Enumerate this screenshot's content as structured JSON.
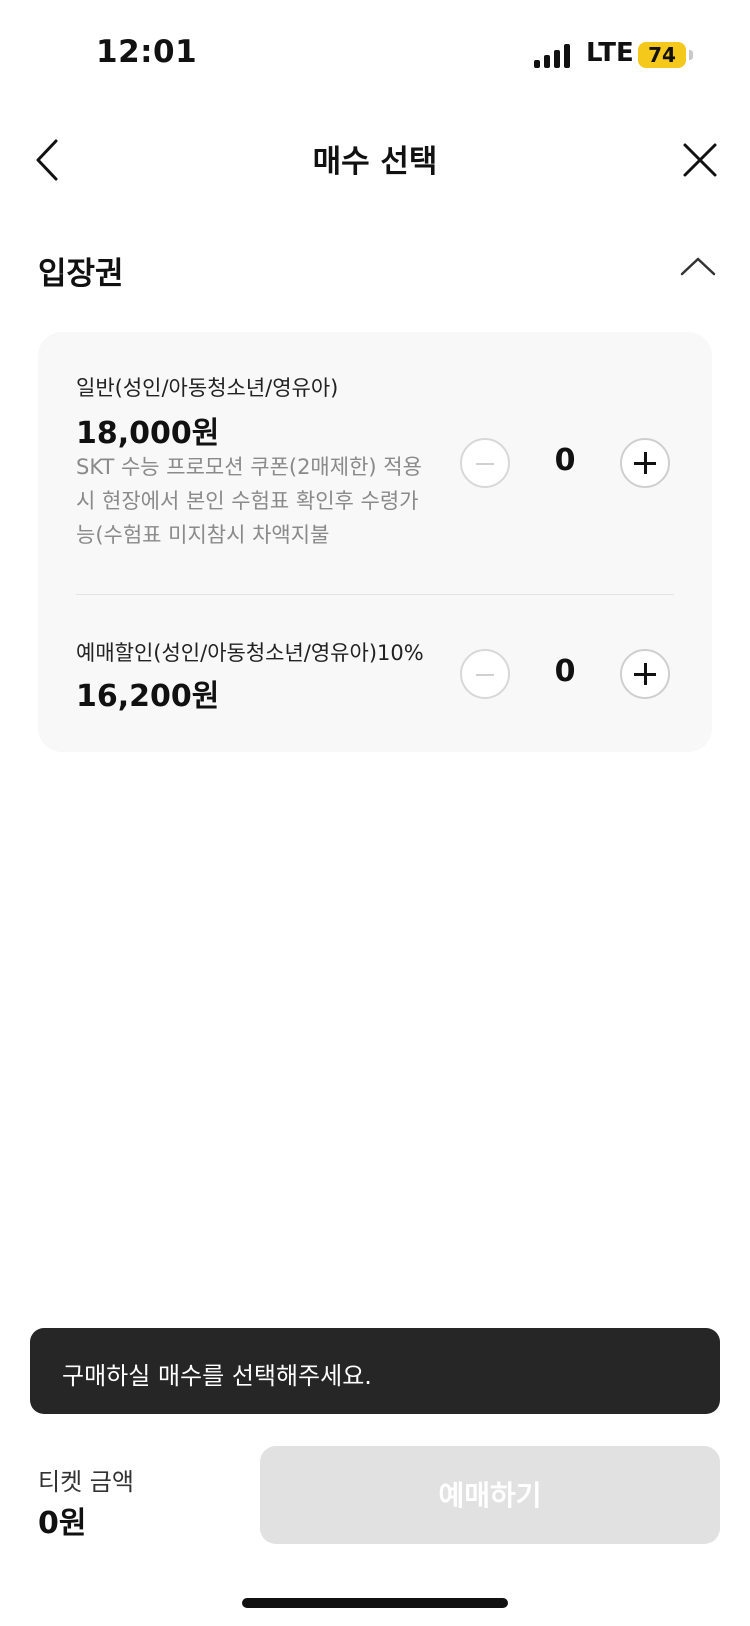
{
  "status_bar": {
    "time": "12:01",
    "network": "LTE",
    "battery": "74"
  },
  "header": {
    "title": "매수 선택",
    "back_icon": "chevron-left-icon",
    "close_icon": "close-icon"
  },
  "section": {
    "title": "입장권",
    "toggle_icon": "chevron-up-icon"
  },
  "tickets": [
    {
      "name": "일반(성인/아동청소년/영유아)",
      "price": "18,000원",
      "description_lines": [
        "SKT 수능 프로모션 쿠폰(2매제한) 적용",
        "시 현장에서 본인 수험표 확인후 수령가",
        "능(수험표 미지참시 차액지불"
      ],
      "quantity": "0"
    },
    {
      "name": "예매할인(성인/아동청소년/영유아)10%",
      "price": "16,200원",
      "quantity": "0"
    }
  ],
  "toast": {
    "message": "구매하실 매수를 선택해주세요."
  },
  "footer": {
    "price_label": "티켓 금액",
    "price_value": "0원",
    "book_label": "예매하기"
  },
  "colors": {
    "battery": "#f5c81c",
    "toast_bg": "#262626",
    "button_disabled": "#e1e1e1",
    "card_bg": "#f8f8f8"
  }
}
